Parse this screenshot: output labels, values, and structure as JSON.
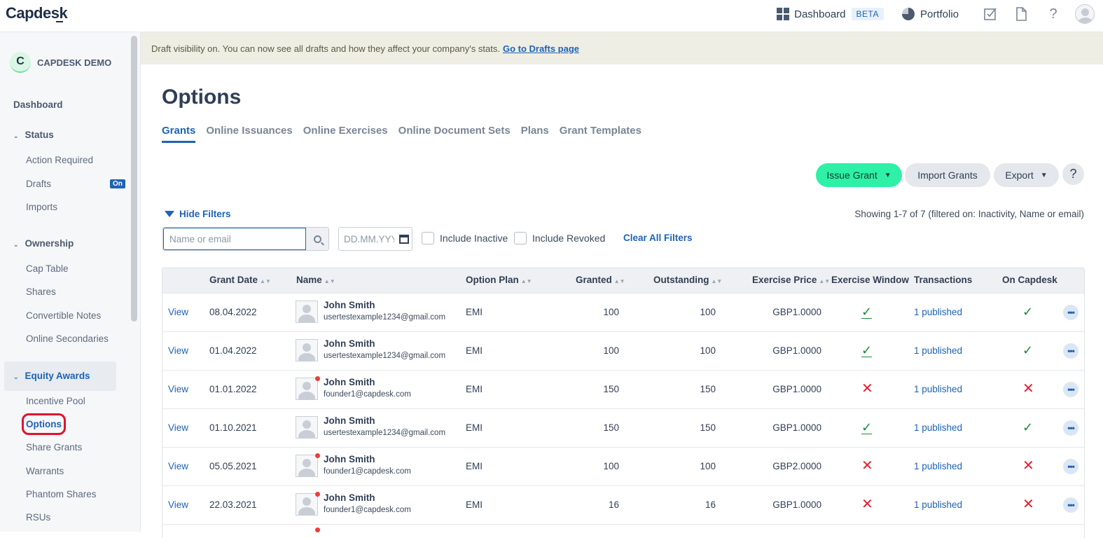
{
  "topbar": {
    "logo": "Capdesk",
    "dashboard_label": "Dashboard",
    "beta_label": "BETA",
    "portfolio_label": "Portfolio",
    "help_label": "?"
  },
  "sidebar": {
    "company_initial": "C",
    "company_name": "CAPDESK DEMO",
    "dashboard": "Dashboard",
    "status_heading": "Status",
    "action_required": "Action Required",
    "drafts": "Drafts",
    "drafts_badge": "On",
    "imports": "Imports",
    "ownership_heading": "Ownership",
    "cap_table": "Cap Table",
    "shares": "Shares",
    "convertible_notes": "Convertible Notes",
    "online_secondaries": "Online Secondaries",
    "equity_awards_heading": "Equity Awards",
    "incentive_pool": "Incentive Pool",
    "options": "Options",
    "share_grants": "Share Grants",
    "warrants": "Warrants",
    "phantom_shares": "Phantom Shares",
    "rsus": "RSUs"
  },
  "banner": {
    "text": "Draft visibility on. You can now see all drafts and how they affect your company's stats.",
    "link": "Go to Drafts page"
  },
  "page": {
    "title": "Options",
    "tabs": [
      "Grants",
      "Online Issuances",
      "Online Exercises",
      "Online Document Sets",
      "Plans",
      "Grant Templates"
    ]
  },
  "actions": {
    "issue_grant": "Issue Grant",
    "import_grants": "Import Grants",
    "export": "Export",
    "help": "?"
  },
  "filters": {
    "hide_filters": "Hide Filters",
    "showing": "Showing 1-7 of 7 (filtered on: Inactivity, Name or email)",
    "search_placeholder": "Name or email",
    "date_placeholder": "DD.MM.YYYY",
    "include_inactive": "Include Inactive",
    "include_revoked": "Include Revoked",
    "clear_all": "Clear All Filters"
  },
  "table": {
    "headers": {
      "grant_date": "Grant Date",
      "name": "Name",
      "option_plan": "Option Plan",
      "granted": "Granted",
      "outstanding": "Outstanding",
      "exercise_price": "Exercise Price",
      "exercise_window": "Exercise Window",
      "transactions": "Transactions",
      "on_capdesk": "On Capdesk"
    },
    "rows": [
      {
        "view": "View",
        "date": "08.04.2022",
        "name": "John Smith",
        "email": "usertestexample1234@gmail.com",
        "plan": "EMI",
        "granted": "100",
        "outstanding": "100",
        "price": "GBP1.0000",
        "window": "check",
        "transactions": "1 published",
        "on_capdesk": "check",
        "dot": false
      },
      {
        "view": "View",
        "date": "01.04.2022",
        "name": "John Smith",
        "email": "usertestexample1234@gmail.com",
        "plan": "EMI",
        "granted": "100",
        "outstanding": "100",
        "price": "GBP1.0000",
        "window": "check",
        "transactions": "1 published",
        "on_capdesk": "check",
        "dot": false
      },
      {
        "view": "View",
        "date": "01.01.2022",
        "name": "John Smith",
        "email": "founder1@capdesk.com",
        "plan": "EMI",
        "granted": "150",
        "outstanding": "150",
        "price": "GBP1.0000",
        "window": "x",
        "transactions": "1 published",
        "on_capdesk": "x",
        "dot": true
      },
      {
        "view": "View",
        "date": "01.10.2021",
        "name": "John Smith",
        "email": "usertestexample1234@gmail.com",
        "plan": "EMI",
        "granted": "150",
        "outstanding": "150",
        "price": "GBP1.0000",
        "window": "check",
        "transactions": "1 published",
        "on_capdesk": "check",
        "dot": false
      },
      {
        "view": "View",
        "date": "05.05.2021",
        "name": "John Smith",
        "email": "founder1@capdesk.com",
        "plan": "EMI",
        "granted": "100",
        "outstanding": "100",
        "price": "GBP2.0000",
        "window": "x",
        "transactions": "1 published",
        "on_capdesk": "x",
        "dot": true
      },
      {
        "view": "View",
        "date": "22.03.2021",
        "name": "John Smith",
        "email": "founder1@capdesk.com",
        "plan": "EMI",
        "granted": "16",
        "outstanding": "16",
        "price": "GBP1.0000",
        "window": "x",
        "transactions": "1 published",
        "on_capdesk": "x",
        "dot": true
      }
    ]
  },
  "colors": {
    "accent": "#1e63b5",
    "issue_button": "#2ef0a6",
    "check": "#1a8a3a",
    "cross": "#e51e2e",
    "highlight_ring": "#e0132e"
  }
}
